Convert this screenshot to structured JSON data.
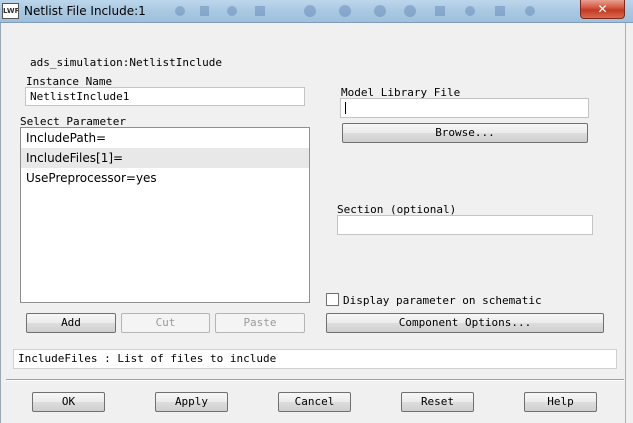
{
  "window": {
    "title": "Netlist File Include:1",
    "close_label": "✕",
    "icon_text": "LWP"
  },
  "component_name": "ads_simulation:NetlistInclude",
  "instance": {
    "label": "Instance Name",
    "value": "NetlistInclude1"
  },
  "parameters": {
    "label": "Select Parameter",
    "items": [
      {
        "label": "IncludePath="
      },
      {
        "label": "IncludeFiles[1]="
      },
      {
        "label": "UsePreprocessor=yes"
      }
    ],
    "selected_index": 1
  },
  "list_buttons": {
    "add": "Add",
    "cut": "Cut",
    "paste": "Paste"
  },
  "model_library": {
    "label": "Model Library File",
    "value": "",
    "browse_label": "Browse..."
  },
  "section": {
    "label": "Section (optional)",
    "value": ""
  },
  "display_parameter": {
    "label": "Display parameter on schematic",
    "checked": false
  },
  "component_options_label": "Component Options...",
  "status_text": "IncludeFiles : List of files to include",
  "footer": {
    "ok": "OK",
    "apply": "Apply",
    "cancel": "Cancel",
    "reset": "Reset",
    "help": "Help"
  }
}
